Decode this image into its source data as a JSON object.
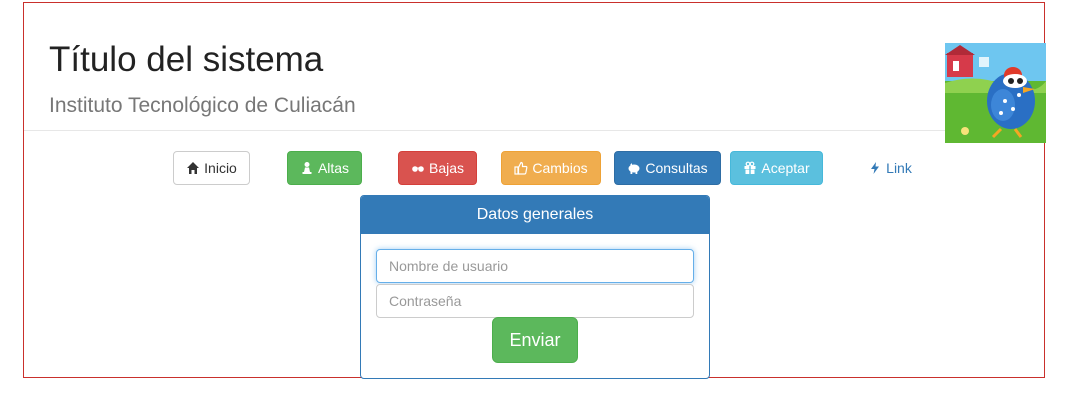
{
  "header": {
    "title": "Título del sistema",
    "subtitle": "Instituto Tecnológico de Culiacán"
  },
  "nav": {
    "inicio": "Inicio",
    "altas": "Altas",
    "bajas": "Bajas",
    "cambios": "Cambios",
    "consultas": "Consultas",
    "aceptar": "Aceptar",
    "link": "Link"
  },
  "form": {
    "heading": "Datos generales",
    "username_placeholder": "Nombre de usuario",
    "password_placeholder": "Contraseña",
    "submit_label": "Enviar"
  },
  "icons": {
    "inicio": "home-icon",
    "altas": "pawn-icon",
    "bajas": "sunglasses-icon",
    "cambios": "thumbs-up-icon",
    "consultas": "piggy-bank-icon",
    "aceptar": "gift-icon",
    "link": "flash-icon"
  },
  "colors": {
    "frame_border": "#c9302c",
    "primary": "#337ab7",
    "success": "#5cb85c",
    "danger": "#d9534f",
    "warning": "#f0ad4e",
    "info": "#5bc0de"
  }
}
